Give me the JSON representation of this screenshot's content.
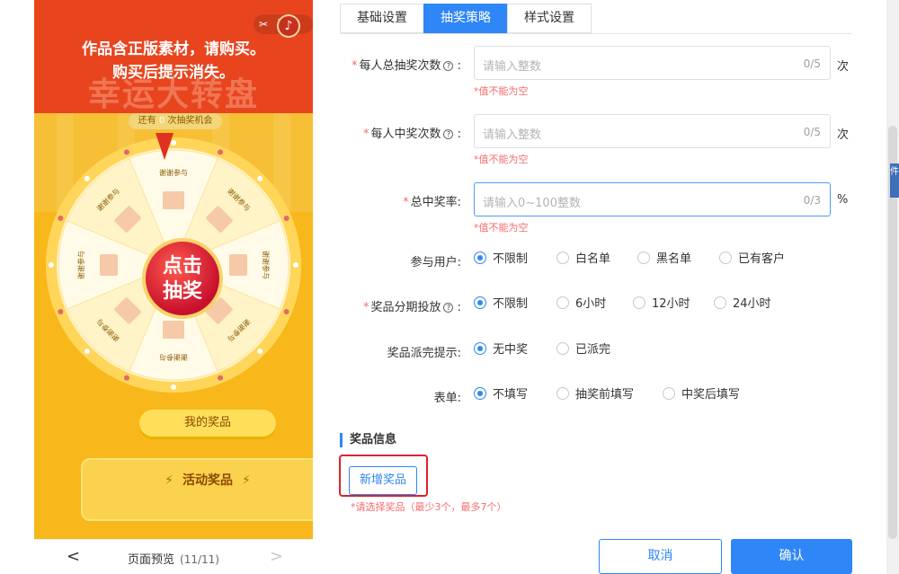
{
  "preview": {
    "activity_label": "活动",
    "tool_icon": "scissors-icon",
    "music_icon": "music-note-icon",
    "watermark_line1": "作品含正版素材，请购买。",
    "watermark_line2": "购买后提示消失。",
    "big_title": "幸运大转盘",
    "chances_prefix": "还有",
    "chances_count": "0",
    "chances_suffix": "次抽奖机会",
    "wheel_segment_label": "谢谢参与",
    "center_line1": "点击",
    "center_line2": "抽奖",
    "my_prizes_button": "我的奖品",
    "activity_prizes_title": "活动奖品",
    "nav_label": "页面预览",
    "nav_count": "(11/11)"
  },
  "tabs": [
    {
      "label": "基础设置",
      "active": false
    },
    {
      "label": "抽奖策略",
      "active": true
    },
    {
      "label": "样式设置",
      "active": false
    }
  ],
  "fields": {
    "total_draws": {
      "label": "每人总抽奖次数",
      "placeholder": "请输入整数",
      "counter": "0/5",
      "unit": "次",
      "error": "*值不能为空"
    },
    "win_times": {
      "label": "每人中奖次数",
      "placeholder": "请输入整数",
      "counter": "0/5",
      "unit": "次",
      "error": "*值不能为空"
    },
    "win_rate": {
      "label": "总中奖率:",
      "placeholder": "请输入0~100整数",
      "counter": "0/3",
      "unit": "%",
      "error": "*值不能为空"
    }
  },
  "radios": {
    "participants": {
      "label": "参与用户:",
      "options": [
        "不限制",
        "白名单",
        "黑名单",
        "已有客户"
      ],
      "selected": 0
    },
    "prize_schedule": {
      "label": "奖品分期投放",
      "options": [
        "不限制",
        "6小时",
        "12小时",
        "24小时"
      ],
      "selected": 0
    },
    "depleted_tip": {
      "label": "奖品派完提示:",
      "options": [
        "无中奖",
        "已派完"
      ],
      "selected": 0
    },
    "form": {
      "label": "表单:",
      "options": [
        "不填写",
        "抽奖前填写",
        "中奖后填写"
      ],
      "selected": 0
    }
  },
  "prize_section": {
    "title": "奖品信息",
    "add_button": "新增奖品",
    "hint": "*请选择奖品（最少3个，最多7个）"
  },
  "footer": {
    "cancel": "取消",
    "confirm": "确认"
  },
  "edge_tab_label": "件",
  "colors": {
    "accent": "#2f86f6",
    "error": "#f56c6c",
    "highlight": "#d9232d",
    "preview_bg": "#f8b71b",
    "preview_top": "#e8451f"
  }
}
